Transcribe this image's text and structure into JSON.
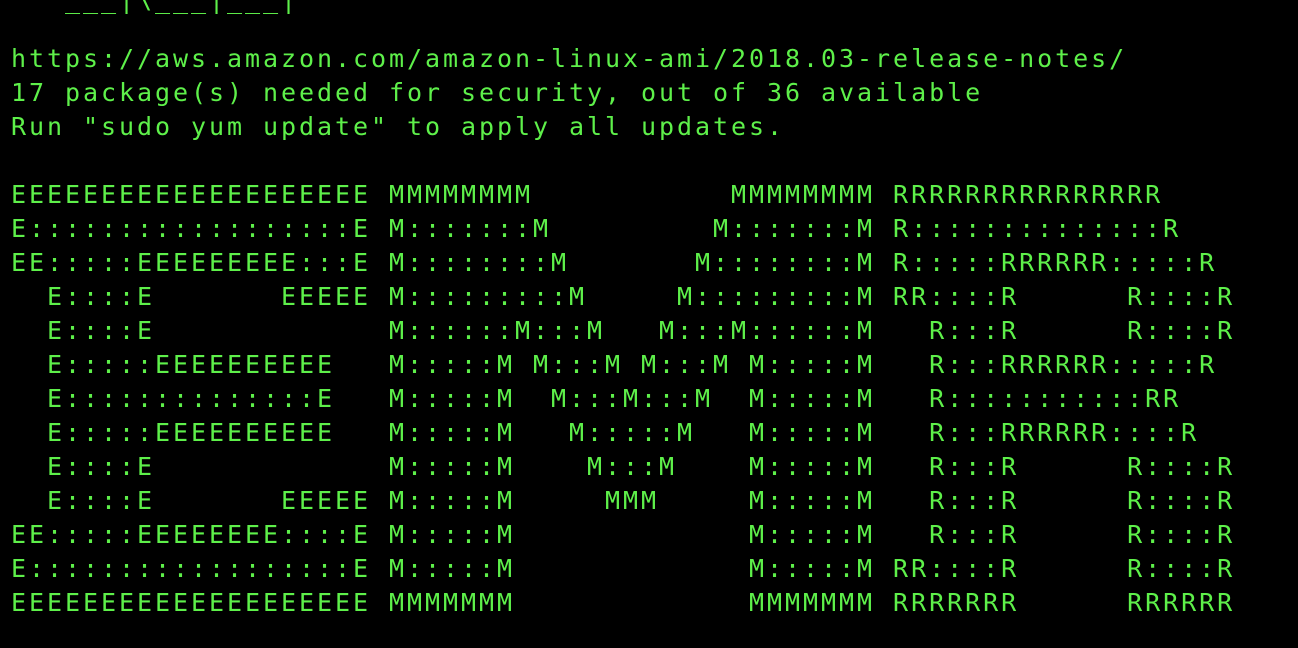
{
  "terminal": {
    "colors": {
      "background": "#000000",
      "foreground": "#5ef04a"
    },
    "top_art_fragment": "   ___|\\___|___|",
    "release_notes_url": "https://aws.amazon.com/amazon-linux-ami/2018.03-release-notes/",
    "security_message": "17 package(s) needed for security, out of 36 available",
    "update_instruction": "Run \"sudo yum update\" to apply all updates.",
    "emr_banner": [
      "EEEEEEEEEEEEEEEEEEEE MMMMMMMM           MMMMMMMM RRRRRRRRRRRRRRR",
      "E::::::::::::::::::E M:::::::M         M:::::::M R::::::::::::::R",
      "EE:::::EEEEEEEEE:::E M::::::::M       M::::::::M R:::::RRRRRR:::::R",
      "  E::::E       EEEEE M:::::::::M     M:::::::::M RR::::R      R::::R",
      "  E::::E             M::::::M:::M   M:::M::::::M   R:::R      R::::R",
      "  E:::::EEEEEEEEEE   M:::::M M:::M M:::M M:::::M   R:::RRRRRR:::::R",
      "  E::::::::::::::E   M:::::M  M:::M:::M  M:::::M   R:::::::::::RR",
      "  E:::::EEEEEEEEEE   M:::::M   M:::::M   M:::::M   R:::RRRRRR::::R",
      "  E::::E             M:::::M    M:::M    M:::::M   R:::R      R::::R",
      "  E::::E       EEEEE M:::::M     MMM     M:::::M   R:::R      R::::R",
      "EE:::::EEEEEEEE::::E M:::::M             M:::::M   R:::R      R::::R",
      "E::::::::::::::::::E M:::::M             M:::::M RR::::R      R::::R",
      "EEEEEEEEEEEEEEEEEEEE MMMMMMM             MMMMMMM RRRRRRR      RRRRRR"
    ]
  }
}
